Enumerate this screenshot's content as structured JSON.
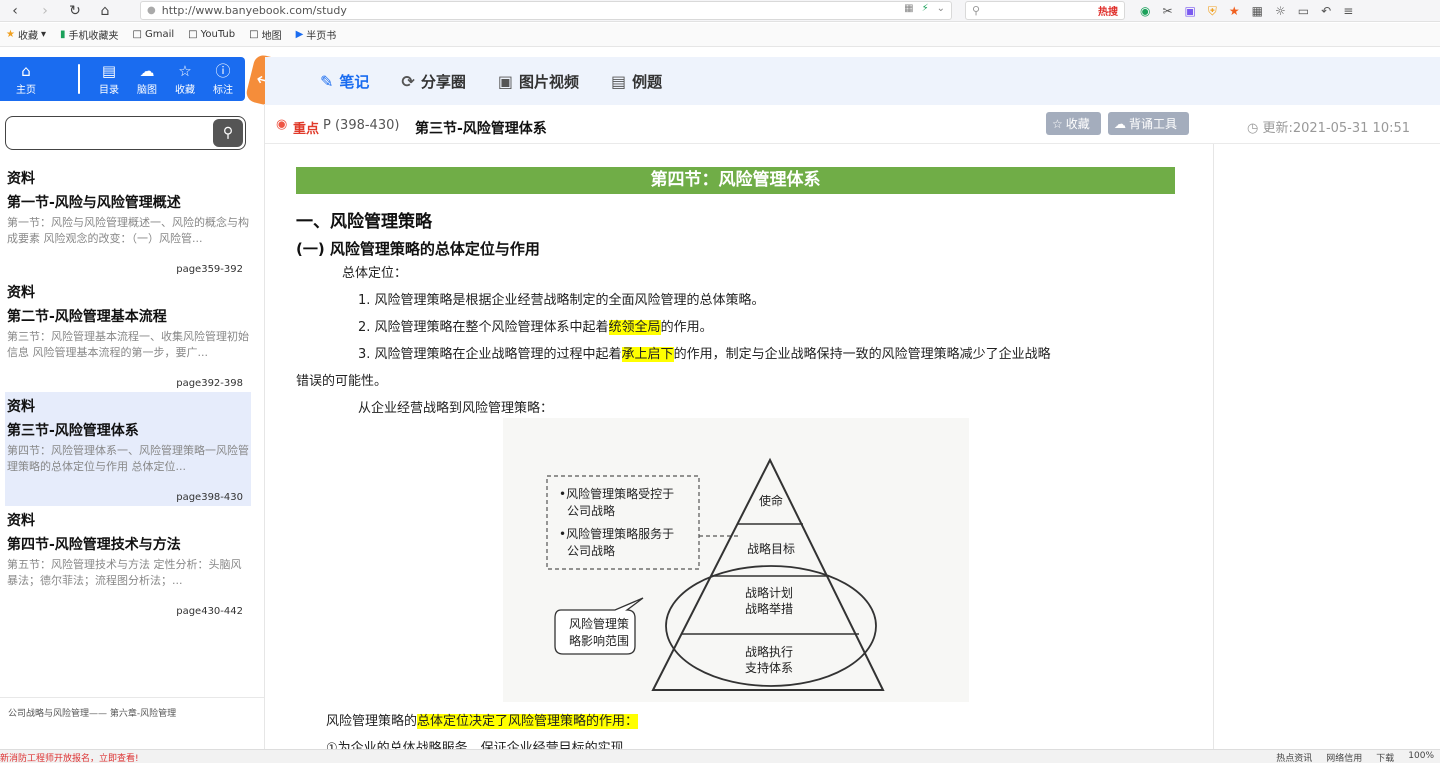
{
  "browser": {
    "url": "http://www.banyebook.com/study",
    "search_hot": "热搜",
    "bookmarks": [
      "收藏",
      "手机收藏夹",
      "Gmail",
      "YouTub",
      "地图",
      "半页书"
    ]
  },
  "toolbar": {
    "home": "主页",
    "catalog": "目录",
    "mindmap": "脑图",
    "favorites": "收藏",
    "annotate": "标注"
  },
  "sidebar": {
    "search_placeholder": "",
    "sections": [
      {
        "tag": "资料",
        "title": "第一节-风险与风险管理概述",
        "excerpt": "第一节：风险与风险管理概述一、风险的概念与构成要素 风险观念的改变：（一）风险管...",
        "page": "page359-392"
      },
      {
        "tag": "资料",
        "title": "第二节-风险管理基本流程",
        "excerpt": "第三节：风险管理基本流程一、收集风险管理初始信息 风险管理基本流程的第一步，要广...",
        "page": "page392-398"
      },
      {
        "tag": "资料",
        "title": "第三节-风险管理体系",
        "excerpt": "第四节：风险管理体系一、风险管理策略一风险管理策略的总体定位与作用 总体定位...",
        "page": "page398-430"
      },
      {
        "tag": "资料",
        "title": "第四节-风险管理技术与方法",
        "excerpt": "第五节：风险管理技术与方法 定性分析：头脑风暴法；德尔菲法；流程图分析法；...",
        "page": "page430-442"
      }
    ],
    "footer": "公司战略与风险管理—— 第六章-风险管理"
  },
  "tabs": [
    "笔记",
    "分享圈",
    "图片视频",
    "例题"
  ],
  "header": {
    "key_label": "重点",
    "pages": "P  (398-430)",
    "title": "第三节-风险管理体系",
    "fav_label": "收藏",
    "tool_label": "背诵工具",
    "update": "更新:2021-05-31 10:51"
  },
  "content": {
    "banner": "第四节：风险管理体系",
    "h1": "一、风险管理策略",
    "h2": "(一) 风险管理策略的总体定位与作用",
    "p_position": "总体定位：",
    "p1": "1. 风险管理策略是根据企业经营战略制定的全面风险管理的总体策略。",
    "p2_a": "2. 风险管理策略在整个风险管理体系中起着",
    "p2_hl": "统领全局",
    "p2_b": "的作用。",
    "p3_a": "3. 风险管理策略在企业战略管理的过程中起着",
    "p3_hl": "承上启下",
    "p3_b": "的作用，制定与企业战略保持一致的风险管理策略减少了企业战略",
    "p3_c": "错误的可能性。",
    "p4": "从企业经营战略到风险管理策略：",
    "p5_a": "风险管理策略的",
    "p5_hl": "总体定位决定了风险管理策略的作用：",
    "p6": "①为企业的总体战略服务，保证企业经营目标的实现"
  },
  "diagram": {
    "box_line1": "•风险管理策略受控于",
    "box_line2": "公司战略",
    "box_line3": "•风险管理策略服务于",
    "box_line4": "公司战略",
    "bubble_line1": "风险管理策",
    "bubble_line2": "略影响范围",
    "level1": "使命",
    "level2": "战略目标",
    "level3a": "战略计划",
    "level3b": "战略举措",
    "level4a": "战略执行",
    "level4b": "支持体系"
  },
  "status": {
    "left": "新消防工程师开放报名，立即查看!",
    "right": [
      "热点资讯",
      "网络信用",
      "下载",
      "100%"
    ]
  },
  "colors": {
    "accent": "#1a6cf0",
    "banner": "#70ad47",
    "highlight": "#ffff00",
    "orange": "#f58d3a"
  }
}
